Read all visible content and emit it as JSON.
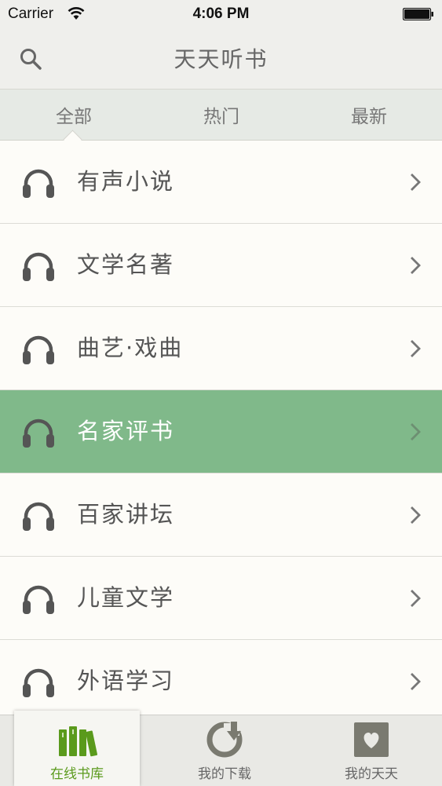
{
  "status_bar": {
    "carrier": "Carrier",
    "time": "4:06 PM"
  },
  "nav": {
    "title": "天天听书"
  },
  "segments": [
    "全部",
    "热门",
    "最新"
  ],
  "categories": [
    {
      "label": "有声小说",
      "selected": false
    },
    {
      "label": "文学名著",
      "selected": false
    },
    {
      "label": "曲艺·戏曲",
      "selected": false
    },
    {
      "label": "名家评书",
      "selected": true
    },
    {
      "label": "百家讲坛",
      "selected": false
    },
    {
      "label": "儿童文学",
      "selected": false
    },
    {
      "label": "外语学习",
      "selected": false
    }
  ],
  "tabs": [
    {
      "label": "在线书库",
      "icon": "books-icon"
    },
    {
      "label": "我的下载",
      "icon": "download-icon"
    },
    {
      "label": "我的天天",
      "icon": "heart-icon"
    }
  ],
  "colors": {
    "selected_row": "#80b98a",
    "active_tab_text": "#5a9a1c"
  }
}
